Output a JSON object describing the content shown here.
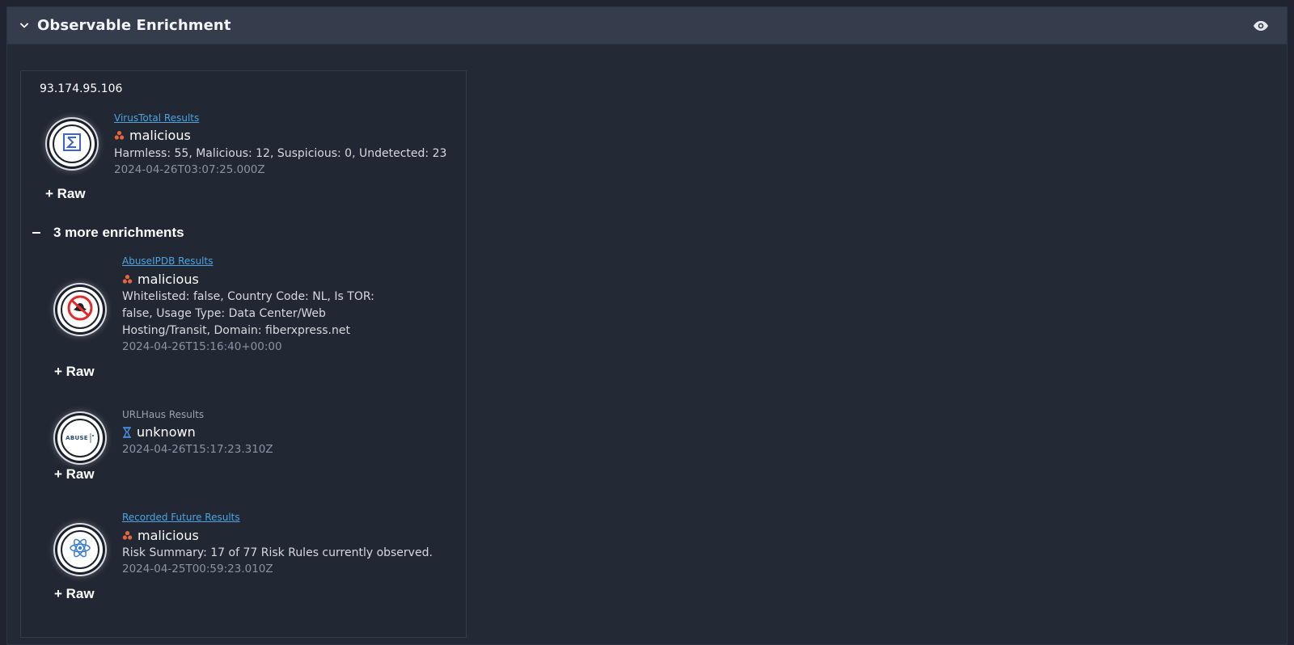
{
  "panel": {
    "title": "Observable Enrichment"
  },
  "observable": {
    "value": "93.174.95.106"
  },
  "primary": {
    "source": "VirusTotal Results",
    "verdict": "malicious",
    "description": "Harmless: 55, Malicious: 12, Suspicious: 0, Undetected: 23",
    "timestamp": "2024-04-26T03:07:25.000Z",
    "raw_label": "+ Raw",
    "logo_icon": "virustotal-sigma-icon"
  },
  "more_toggle": {
    "label": "3 more enrichments"
  },
  "enrichments": [
    {
      "source": "AbuseIPDB Results",
      "verdict": "malicious",
      "description": "Whitelisted: false, Country Code: NL, Is TOR: false, Usage Type: Data Center/Web Hosting/Transit, Domain: fiberxpress.net",
      "timestamp": "2024-04-26T15:16:40+00:00",
      "raw_label": "+ Raw",
      "logo_icon": "abuseipdb-hat-icon"
    },
    {
      "source": "URLHaus Results",
      "verdict": "unknown",
      "description": "",
      "timestamp": "2024-04-26T15:17:23.310Z",
      "raw_label": "+ Raw",
      "logo_icon": "abuse-ch-icon",
      "logo_text": "ABUSE"
    },
    {
      "source": "Recorded Future Results",
      "verdict": "malicious",
      "description": "Risk Summary: 17 of 77 Risk Rules currently observed.",
      "timestamp": "2024-04-25T00:59:23.010Z",
      "raw_label": "+ Raw",
      "logo_icon": "recorded-future-atom-icon"
    }
  ],
  "colors": {
    "malicious": "#e8663c",
    "unknown": "#4a90e2",
    "link": "#4ea3e0"
  }
}
